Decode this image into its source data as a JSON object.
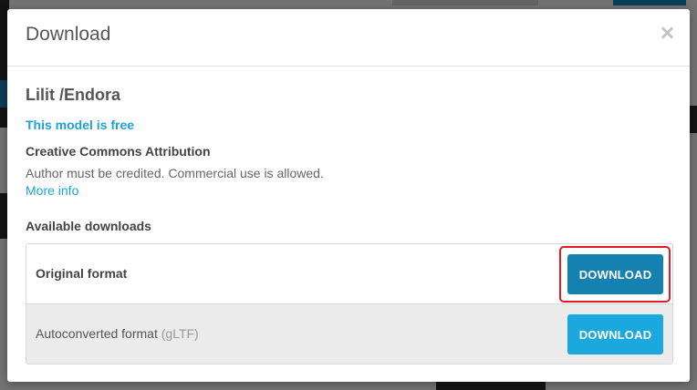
{
  "modal": {
    "title": "Download",
    "model_name": "Lilit /Endora",
    "free_note": "This model is free",
    "license": {
      "title": "Creative Commons Attribution",
      "description": "Author must be credited. Commercial use is allowed.",
      "more_info": "More info"
    },
    "downloads_title": "Available downloads",
    "downloads": [
      {
        "label": "Original format",
        "note": "",
        "button": "DOWNLOAD"
      },
      {
        "label": "Autoconverted format",
        "note": "(gLTF)",
        "button": "DOWNLOAD"
      }
    ]
  },
  "colors": {
    "accent": "#1ba3d6",
    "primary_button": "#1581b0",
    "secondary_button": "#1ba9dd",
    "highlight": "#e01b24"
  },
  "icons": {
    "close": "close-icon"
  }
}
